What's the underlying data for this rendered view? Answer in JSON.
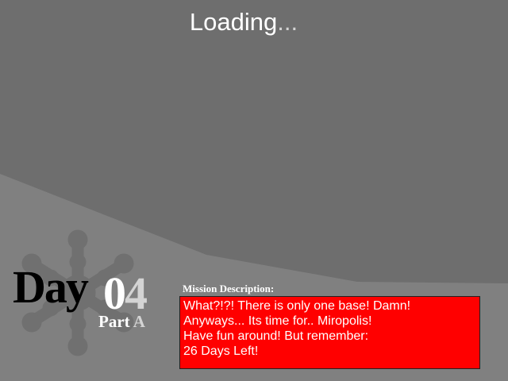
{
  "loading": {
    "word": "Loading",
    "dots": "..."
  },
  "day": {
    "label": "Day",
    "number_first": "0",
    "number_second": "4"
  },
  "part": {
    "word": "Part",
    "letter": "A"
  },
  "mission": {
    "heading": "Mission Description:",
    "lines": [
      "What?!?! There is only one base! Damn!",
      "Anyways... Its time for.. Miropolis!",
      "Have fun around! But remember:",
      "26 Days Left!"
    ]
  },
  "colors": {
    "background_dark": "#6e6e6e",
    "background_light": "#808080",
    "emblem": "#707070",
    "mission_box": "#ff0000",
    "text_white": "#ffffff",
    "text_silver": "#d4d4d4",
    "day_text": "#000000"
  },
  "icons": {
    "emblem": "snowflake-gear-emblem-icon"
  }
}
